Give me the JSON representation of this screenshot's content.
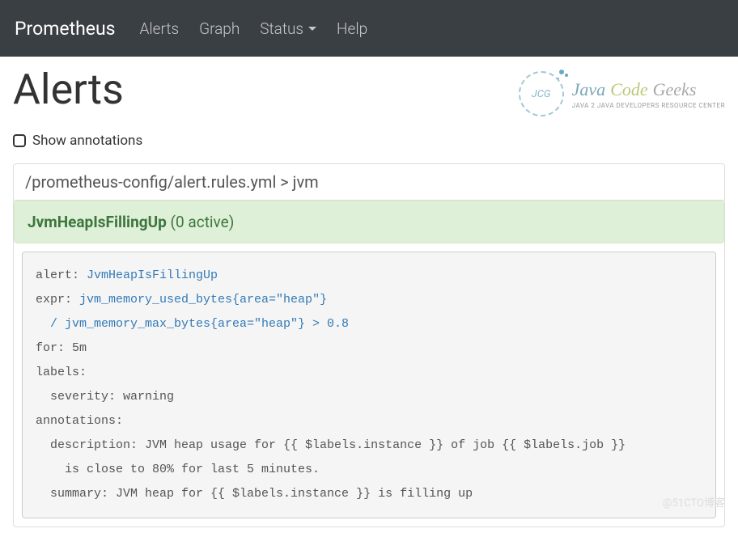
{
  "navbar": {
    "brand": "Prometheus",
    "items": [
      "Alerts",
      "Graph",
      "Status",
      "Help"
    ],
    "dropdown_index": 2
  },
  "page": {
    "title": "Alerts",
    "show_annotations_label": "Show annotations"
  },
  "logo": {
    "circle_text": "JCG",
    "word1": "Java",
    "word2": "Code",
    "word3": "Geeks",
    "tagline": "JAVA 2 JAVA DEVELOPERS RESOURCE CENTER"
  },
  "rules": {
    "file_path": "/prometheus-config/alert.rules.yml > jvm",
    "alert_name": "JvmHeapIsFillingUp",
    "active_count_text": "(0 active)"
  },
  "code": {
    "l1_key": "alert: ",
    "l1_val": "JvmHeapIsFillingUp",
    "l2_key": "expr: ",
    "l2_val": "jvm_memory_used_bytes{area=\"heap\"}",
    "l3_val": "  / jvm_memory_max_bytes{area=\"heap\"} > 0.8",
    "l4": "for: 5m",
    "l5": "labels:",
    "l6": "  severity: warning",
    "l7": "annotations:",
    "l8": "  description: JVM heap usage for {{ $labels.instance }} of job {{ $labels.job }}",
    "l9": "    is close to 80% for last 5 minutes.",
    "l10": "  summary: JVM heap for {{ $labels.instance }} is filling up"
  },
  "watermark": "@51CTO博客"
}
